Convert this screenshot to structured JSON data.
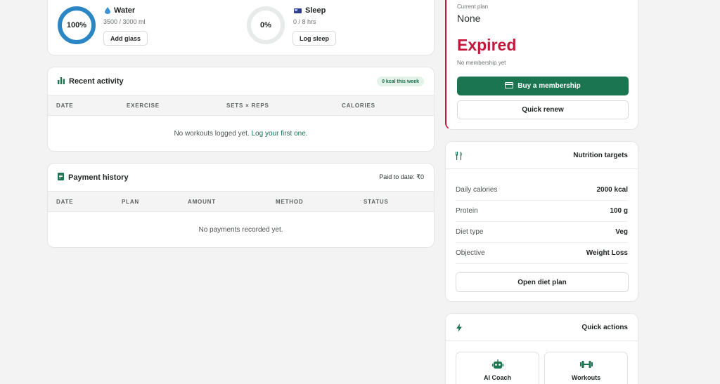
{
  "tracker": {
    "water": {
      "title": "Water",
      "percent_label": "100%",
      "percent": 1.0,
      "amount": "3500 / 3000 ml",
      "button": "Add glass"
    },
    "sleep": {
      "title": "Sleep",
      "percent_label": "0%",
      "percent": 0.0,
      "amount": "0 / 8 hrs",
      "button": "Log sleep"
    }
  },
  "activity": {
    "title": "Recent activity",
    "badge": "0 kcal this week",
    "columns": [
      "DATE",
      "EXERCISE",
      "SETS × REPS",
      "CALORIES"
    ],
    "empty_text": "No workouts logged yet.",
    "empty_link": "Log your first one."
  },
  "payments": {
    "title": "Payment history",
    "paid_to_date": "Paid to date: ₹0",
    "columns": [
      "DATE",
      "PLAN",
      "AMOUNT",
      "METHOD",
      "STATUS"
    ],
    "empty_text": "No payments recorded yet."
  },
  "membership": {
    "current_plan_label": "Current plan",
    "current_plan": "None",
    "status": "Expired",
    "note": "No membership yet",
    "buy_button": "Buy a membership",
    "renew_button": "Quick renew"
  },
  "nutrition": {
    "title": "Nutrition targets",
    "rows": [
      {
        "label": "Daily calories",
        "value": "2000 kcal"
      },
      {
        "label": "Protein",
        "value": "100 g"
      },
      {
        "label": "Diet type",
        "value": "Veg"
      },
      {
        "label": "Objective",
        "value": "Weight Loss"
      }
    ],
    "button": "Open diet plan"
  },
  "quick_actions": {
    "title": "Quick actions",
    "tiles": [
      {
        "label": "AI Coach",
        "icon": "robot-icon"
      },
      {
        "label": "Workouts",
        "icon": "dumbbell-icon"
      }
    ]
  },
  "colors": {
    "accent_green": "#1b7550",
    "expired_red": "#c2183c",
    "water_blue": "#2b86c5"
  }
}
